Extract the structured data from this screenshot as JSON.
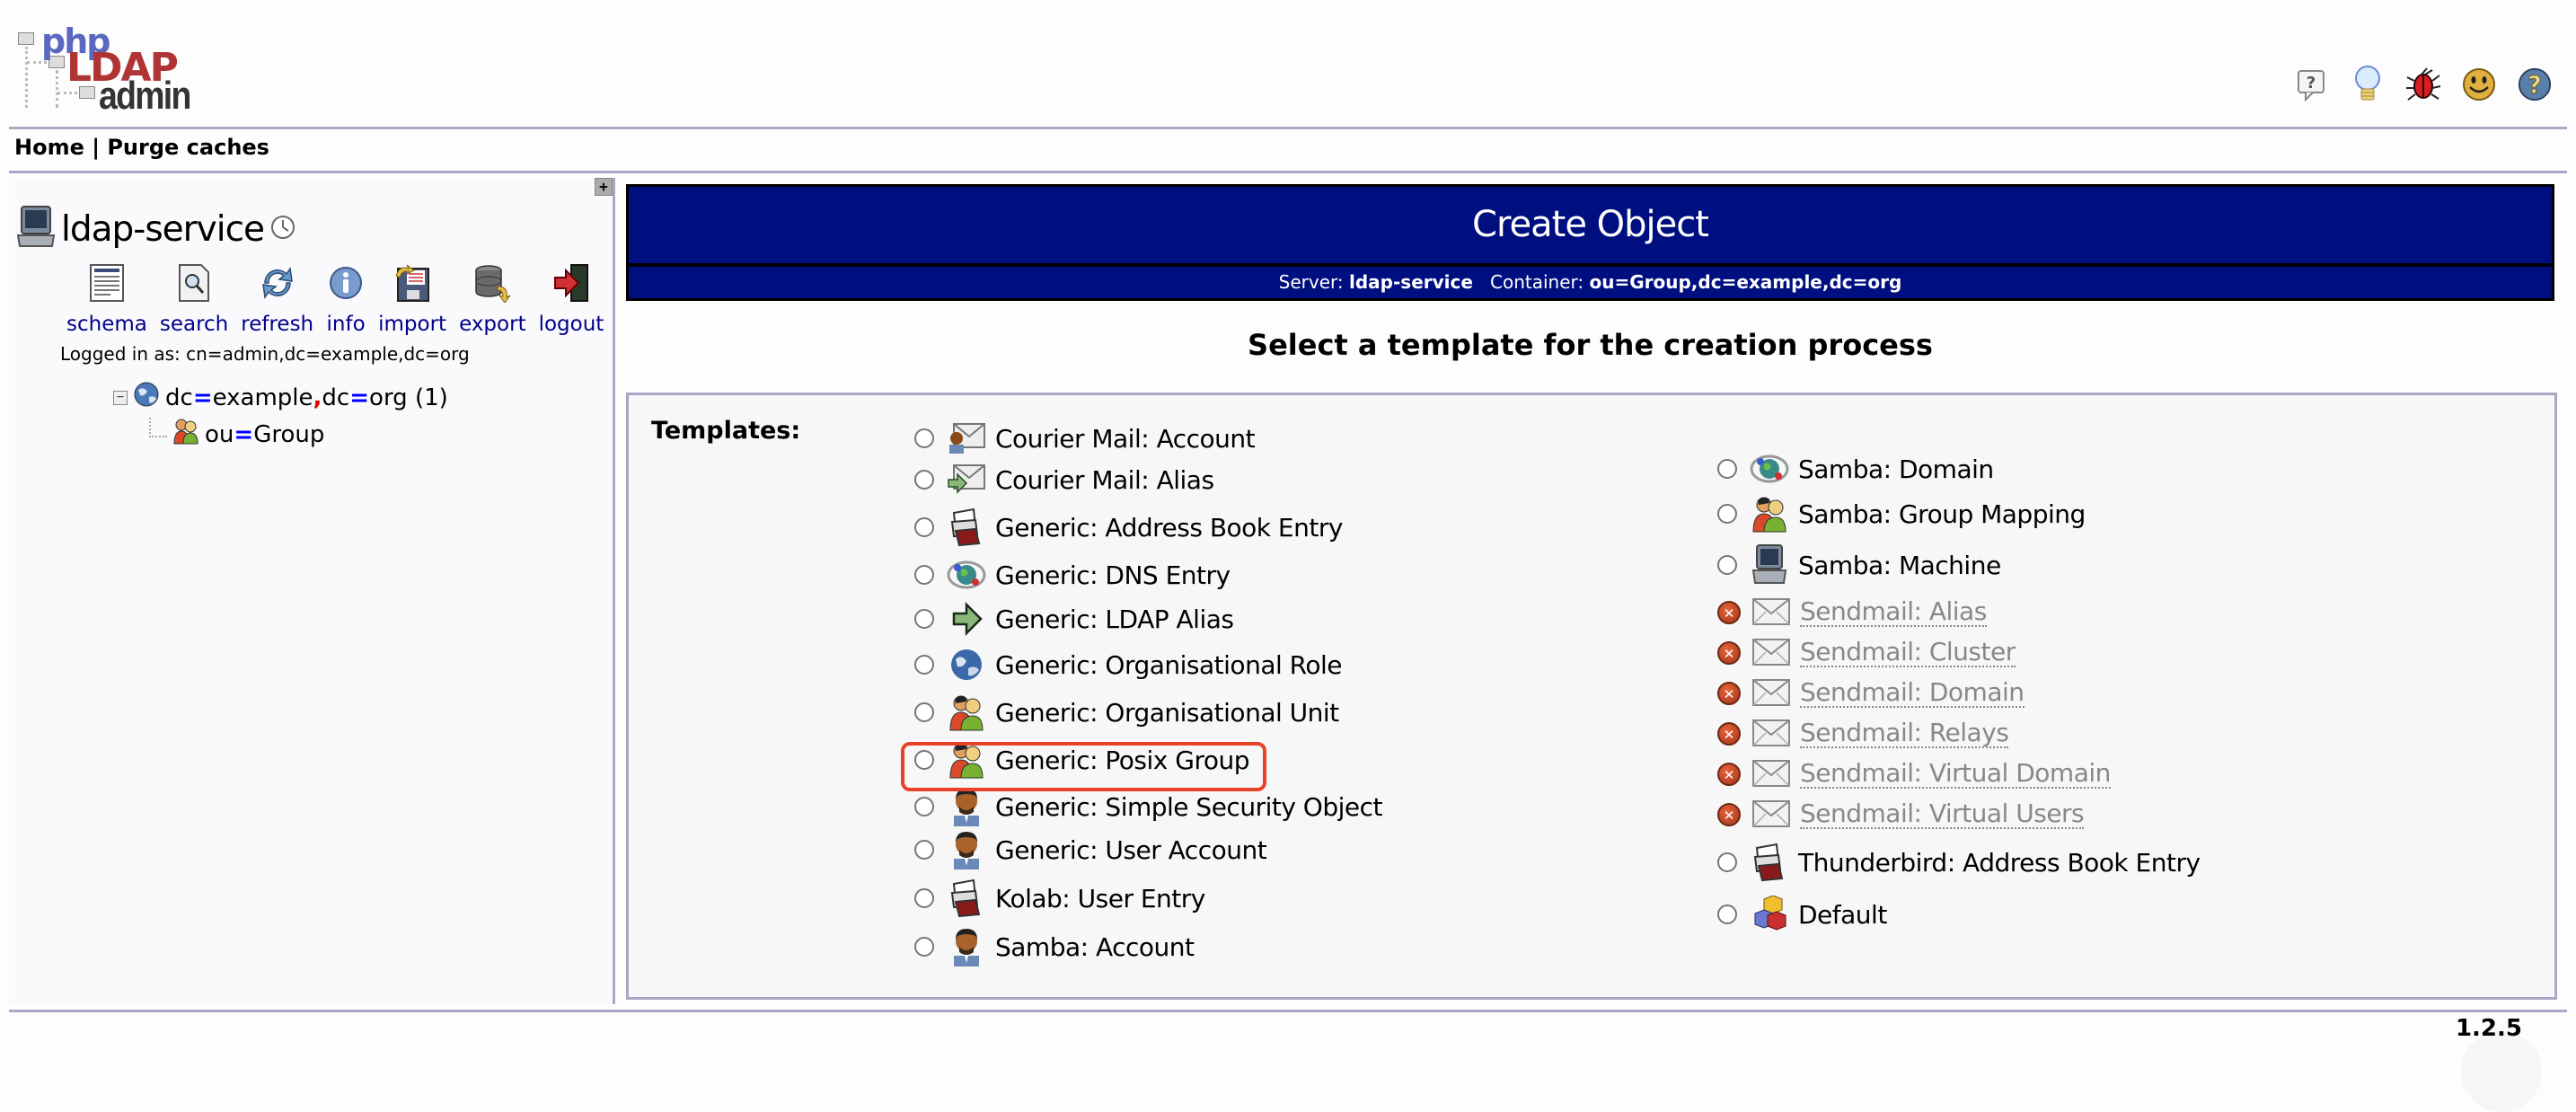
{
  "app": {
    "logo": {
      "line1": "php",
      "line2": "LDAP",
      "line3": "admin"
    },
    "top_icons": [
      {
        "name": "help-speech-icon",
        "label": "Help"
      },
      {
        "name": "lightbulb-icon",
        "label": "Request feature"
      },
      {
        "name": "bug-icon",
        "label": "Report a bug"
      },
      {
        "name": "smiley-icon",
        "label": "Donate"
      },
      {
        "name": "question-globe-icon",
        "label": "Help"
      }
    ],
    "nav": {
      "home": "Home",
      "separator": "|",
      "purge": "Purge caches"
    }
  },
  "sidebar": {
    "server_name": "ldap-service",
    "toolbar": [
      {
        "icon": "schema-icon",
        "label": "schema"
      },
      {
        "icon": "search-icon",
        "label": "search"
      },
      {
        "icon": "refresh-icon",
        "label": "refresh"
      },
      {
        "icon": "info-icon",
        "label": "info"
      },
      {
        "icon": "import-icon",
        "label": "import"
      },
      {
        "icon": "export-icon",
        "label": "export"
      },
      {
        "icon": "logout-icon",
        "label": "logout"
      }
    ],
    "logged_in": "Logged in as: cn=admin,dc=example,dc=org",
    "tree": {
      "root": {
        "a1": "dc",
        "eq": "=",
        "v1": "example",
        "sep": ",",
        "a2": "dc",
        "v2": "org",
        "count": "(1)"
      },
      "child": {
        "attr": "ou",
        "eq": "=",
        "value": "Group"
      }
    }
  },
  "main": {
    "title": "Create Object",
    "server_label": "Server:",
    "server": "ldap-service",
    "container_label": "Container:",
    "container": "ou=Group,dc=example,dc=org",
    "heading": "Select a template for the creation process",
    "templates_label": "Templates:",
    "templates_left": [
      {
        "label": "Courier Mail: Account",
        "icon": "mail-user-icon",
        "enabled": true
      },
      {
        "label": "Courier Mail: Alias",
        "icon": "mail-alias-icon",
        "enabled": true
      },
      {
        "label": "Generic: Address Book Entry",
        "icon": "address-book-icon",
        "enabled": true
      },
      {
        "label": "Generic: DNS Entry",
        "icon": "dns-icon",
        "enabled": true
      },
      {
        "label": "Generic: LDAP Alias",
        "icon": "arrow-alias-icon",
        "enabled": true
      },
      {
        "label": "Generic: Organisational Role",
        "icon": "globe-icon",
        "enabled": true
      },
      {
        "label": "Generic: Organisational Unit",
        "icon": "group-icon",
        "enabled": true
      },
      {
        "label": "Generic: Posix Group",
        "icon": "group-icon",
        "enabled": true,
        "highlighted": true
      },
      {
        "label": "Generic: Simple Security Object",
        "icon": "user-icon",
        "enabled": true
      },
      {
        "label": "Generic: User Account",
        "icon": "user-icon",
        "enabled": true
      },
      {
        "label": "Kolab: User Entry",
        "icon": "address-book-icon",
        "enabled": true
      },
      {
        "label": "Samba: Account",
        "icon": "user-icon",
        "enabled": true
      }
    ],
    "templates_right": [
      {
        "label": "Samba: Domain",
        "icon": "dns-icon",
        "enabled": true
      },
      {
        "label": "Samba: Group Mapping",
        "icon": "group-icon",
        "enabled": true
      },
      {
        "label": "Samba: Machine",
        "icon": "computer-icon",
        "enabled": true
      },
      {
        "label": "Sendmail: Alias",
        "icon": "mail-icon",
        "enabled": false
      },
      {
        "label": "Sendmail: Cluster",
        "icon": "mail-icon",
        "enabled": false
      },
      {
        "label": "Sendmail: Domain",
        "icon": "mail-icon",
        "enabled": false
      },
      {
        "label": "Sendmail: Relays",
        "icon": "mail-icon",
        "enabled": false
      },
      {
        "label": "Sendmail: Virtual Domain",
        "icon": "mail-icon",
        "enabled": false
      },
      {
        "label": "Sendmail: Virtual Users",
        "icon": "mail-icon",
        "enabled": false
      },
      {
        "label": "Thunderbird: Address Book Entry",
        "icon": "address-book-icon",
        "enabled": true
      },
      {
        "label": "Default",
        "icon": "cubes-icon",
        "enabled": true
      }
    ]
  },
  "footer": {
    "version": "1.2.5"
  },
  "colors": {
    "header_bg": "#000f80",
    "rule": "#a8a8c6",
    "link": "#00008b",
    "highlight": "#e8432a",
    "disabled": "#888888"
  }
}
